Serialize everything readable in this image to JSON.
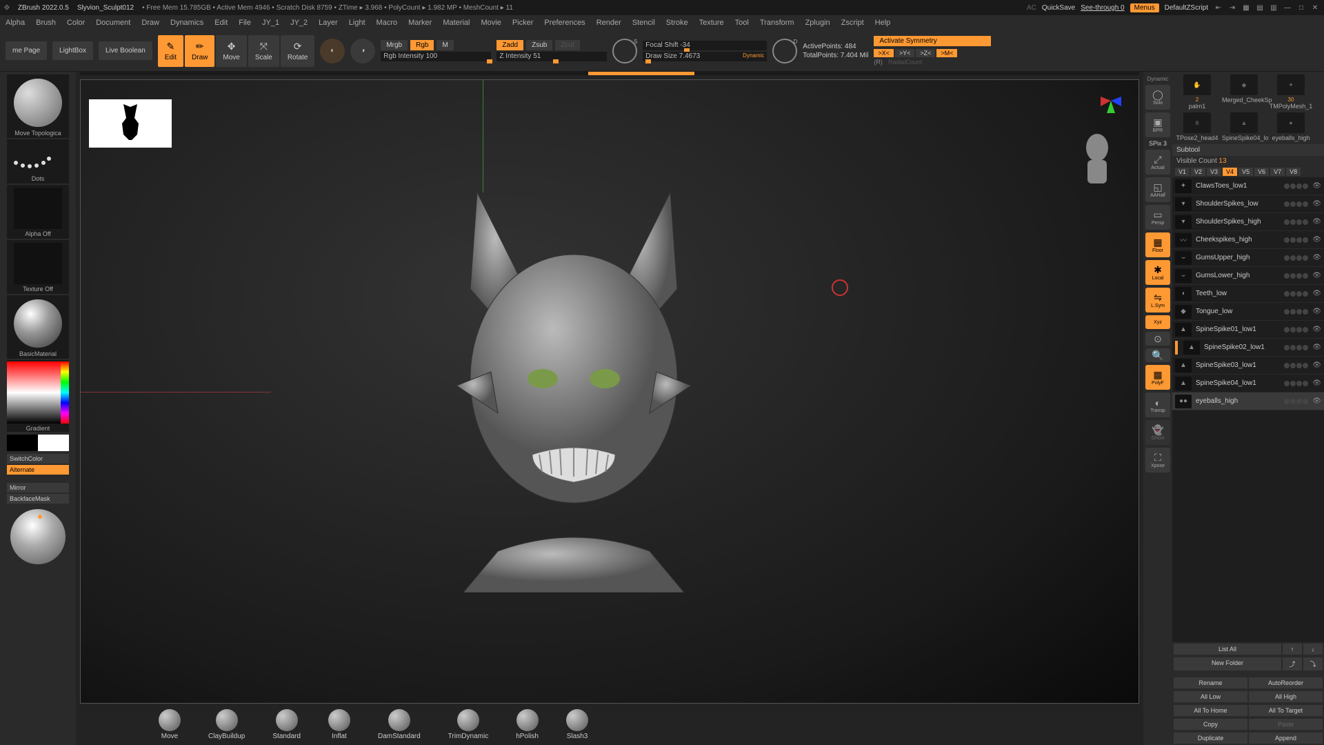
{
  "titlebar": {
    "app": "ZBrush 2022.0.5",
    "file": "Slyvion_Sculpt012",
    "stats": "• Free Mem 15.785GB • Active Mem 4946 • Scratch Disk 8759 • ZTime ▸ 3.968 • PolyCount ▸ 1.982 MP  • MeshCount ▸ 11",
    "ac": "AC",
    "quicksave": "QuickSave",
    "seethrough": "See-through  0",
    "menus": "Menus",
    "zscript": "DefaultZScript"
  },
  "menus": [
    "Alpha",
    "Brush",
    "Color",
    "Document",
    "Draw",
    "Dynamics",
    "Edit",
    "File",
    "JY_1",
    "JY_2",
    "Layer",
    "Light",
    "Macro",
    "Marker",
    "Material",
    "Movie",
    "Picker",
    "Preferences",
    "Render",
    "Stencil",
    "Stroke",
    "Texture",
    "Tool",
    "Transform",
    "Zplugin",
    "Zscript",
    "Help"
  ],
  "toolbar": {
    "homepage": "me Page",
    "lightbox": "LightBox",
    "livebool": "Live Boolean",
    "modes": [
      "Edit",
      "Draw",
      "Move",
      "Scale",
      "Rotate"
    ],
    "mrgb": "Mrgb",
    "rgb": "Rgb",
    "m": "M",
    "rgb_intensity_label": "Rgb Intensity",
    "rgb_intensity_val": "100",
    "zadd": "Zadd",
    "zsub": "Zsub",
    "zcut": "Zcut",
    "z_intensity_label": "Z Intensity",
    "z_intensity_val": "51",
    "focal_label": "Focal Shift",
    "focal_val": "-34",
    "drawsize_label": "Draw Size",
    "drawsize_val": "7.4673",
    "dynamic": "Dynamic",
    "active_pts_label": "ActivePoints:",
    "active_pts_val": "484",
    "total_pts_label": "TotalPoints:",
    "total_pts_val": "7.404 Mil",
    "activate_sym": "Activate Symmetry",
    "sym": [
      ">X<",
      ">Y<",
      ">Z<",
      ">M<"
    ],
    "r": "(R)",
    "radialcount": "RadialCount"
  },
  "left": {
    "brush": "Move Topologica",
    "stroke": "Dots",
    "alpha": "Alpha Off",
    "texture": "Texture Off",
    "material": "BasicMaterial",
    "gradient": "Gradient",
    "switchcolor": "SwitchColor",
    "alternate": "Alternate",
    "mirror": "Mirror",
    "backface": "BackfaceMask"
  },
  "rail": {
    "dynamic": "Dynamic",
    "solo": "Solo",
    "bpr": "BPR",
    "spix": "SPix 3",
    "actual": "Actual",
    "aahalf": "AAHalf",
    "persp": "Persp",
    "floor": "Floor",
    "local": "Local",
    "lsym": "L.Sym",
    "xyz": "Xyz",
    "polyf": "PolyF",
    "transp": "Transp",
    "ghost": "Ghost",
    "xpose": "Xpose"
  },
  "brushshelf": [
    "Move",
    "ClayBuildup",
    "Standard",
    "Inflat",
    "DamStandard",
    "TrimDynamic",
    "hPolish",
    "Slash3"
  ],
  "tools": {
    "items": [
      {
        "name": "palm1",
        "extra": "2",
        "icon": "✋"
      },
      {
        "name": "Merged_CheekSp",
        "icon": "◆"
      },
      {
        "name": "TMPolyMesh_1",
        "extra": "30",
        "icon": "✦"
      },
      {
        "name": "TPose2_head4",
        "icon": "⋔"
      },
      {
        "name": "SpineSpike04_lo",
        "icon": "▲"
      },
      {
        "name": "eyeballs_high",
        "icon": "●"
      }
    ]
  },
  "subtool": {
    "header": "Subtool",
    "visible_label": "Visible Count",
    "visible_val": "13",
    "vbtns": [
      "V1",
      "V2",
      "V3",
      "V4",
      "V5",
      "V6",
      "V7",
      "V8"
    ],
    "vactive": "V4",
    "items": [
      {
        "name": "ClawsToes_low1",
        "icon": "✦"
      },
      {
        "name": "ShoulderSpikes_low",
        "icon": "▾"
      },
      {
        "name": "ShoulderSpikes_high",
        "icon": "▾"
      },
      {
        "name": "Cheekspikes_high",
        "icon": "〰"
      },
      {
        "name": "GumsUpper_high",
        "icon": "⌣"
      },
      {
        "name": "GumsLower_high",
        "icon": "⌣"
      },
      {
        "name": "Teeth_low",
        "icon": "◗"
      },
      {
        "name": "Tongue_low",
        "icon": "◆"
      },
      {
        "name": "SpineSpike01_low1",
        "icon": "▲"
      },
      {
        "name": "SpineSpike02_low1",
        "icon": "▲",
        "active": true
      },
      {
        "name": "SpineSpike03_low1",
        "icon": "▲"
      },
      {
        "name": "SpineSpike04_low1",
        "icon": "▲"
      },
      {
        "name": "eyeballs_high",
        "icon": "●●",
        "sel": true
      }
    ],
    "listall": "List All",
    "newfolder": "New Folder",
    "rename": "Rename",
    "autoreorder": "AutoReorder",
    "alllow": "All Low",
    "allhigh": "All High",
    "alltohome": "All To Home",
    "alltotarget": "All To Target",
    "copy": "Copy",
    "paste": "Paste",
    "duplicate": "Duplicate",
    "append": "Append"
  }
}
